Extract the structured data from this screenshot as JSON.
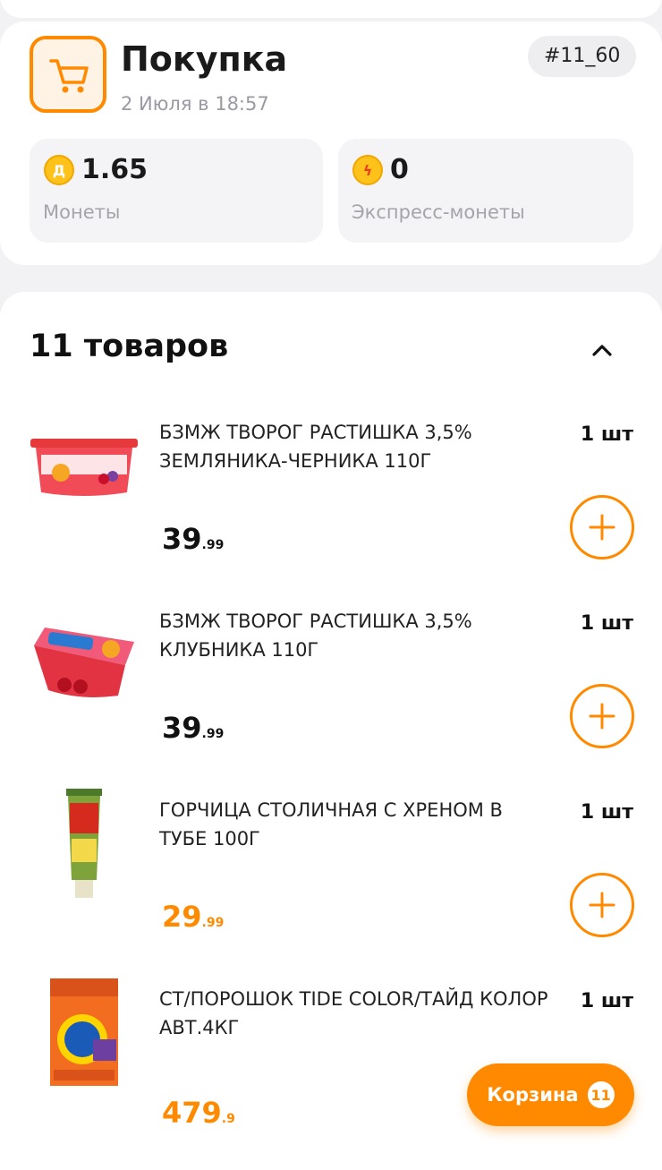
{
  "purchase": {
    "title": "Покупка",
    "date": "2 Июля в 18:57",
    "order_id": "#11_60",
    "coins": {
      "value": "1.65",
      "label": "Монеты",
      "icon": "coin-d-icon",
      "icon_glyph": "Д"
    },
    "express_coins": {
      "value": "0",
      "label": "Экспресс-монеты",
      "icon": "lightning-coin-icon",
      "icon_glyph": "ϟ"
    }
  },
  "goods": {
    "title": "11 товаров",
    "items": [
      {
        "name": "БЗМЖ ТВОРОГ РАСТИШКА 3,5% ЗЕМЛЯНИКА-ЧЕРНИКА 110Г",
        "qty": "1 шт",
        "price_main": "39",
        "price_cents": ".99",
        "price_color": "#111111",
        "image": "yogurt-cup-strawberry-blueberry"
      },
      {
        "name": "БЗМЖ ТВОРОГ РАСТИШКА 3,5% КЛУБНИКА 110Г",
        "qty": "1 шт",
        "price_main": "39",
        "price_cents": ".99",
        "price_color": "#111111",
        "image": "yogurt-cup-strawberry"
      },
      {
        "name": "ГОРЧИЦА СТОЛИЧНАЯ С ХРЕНОМ В ТУБЕ 100Г",
        "qty": "1 шт",
        "price_main": "29",
        "price_cents": ".99",
        "price_color": "#ff8a00",
        "image": "mustard-tube"
      },
      {
        "name": "СТ/ПОРОШОК TIDE COLOR/ТАЙД КОЛОР АВТ.4КГ",
        "qty": "1 шт",
        "price_main": "479",
        "price_cents": ".9",
        "price_color": "#ff8a00",
        "image": "tide-detergent-pack"
      }
    ]
  },
  "basket": {
    "label": "Корзина",
    "count": "11"
  },
  "colors": {
    "accent": "#ff8a00",
    "background": "#f2f2f4",
    "card": "#ffffff"
  }
}
